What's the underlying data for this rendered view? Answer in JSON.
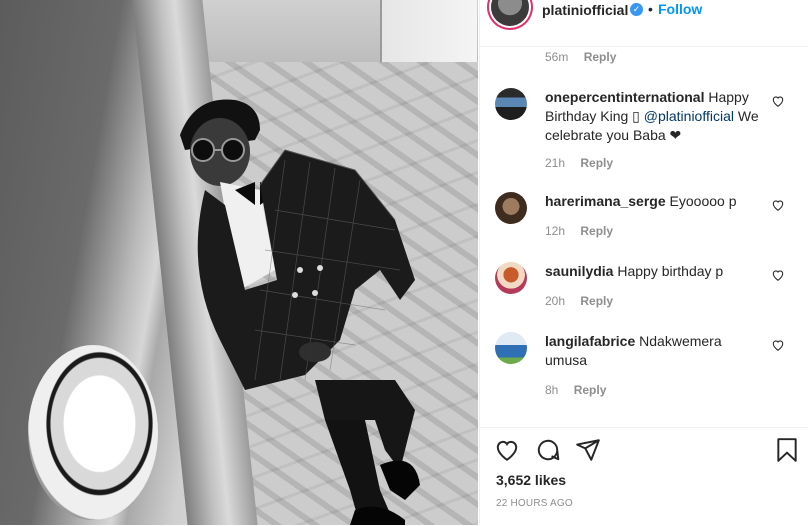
{
  "post": {
    "username": "platiniofficial",
    "verified": true,
    "separator": "•",
    "follow_label": "Follow",
    "photo_description_icon": "black-and-white-portrait-photo"
  },
  "top_meta": {
    "time": "56m",
    "reply_label": "Reply"
  },
  "comments": [
    {
      "username": "onepercentinternational",
      "text_before": "Happy Birthday King ▯ ",
      "mention": "@platiniofficial",
      "text_after": " We celebrate you Baba ❤",
      "time": "21h",
      "reply_label": "Reply"
    },
    {
      "username": "harerimana_serge",
      "text_before": "Eyooooo p",
      "mention": "",
      "text_after": "",
      "time": "12h",
      "reply_label": "Reply"
    },
    {
      "username": "saunilydia",
      "text_before": "Happy birthday p",
      "mention": "",
      "text_after": "",
      "time": "20h",
      "reply_label": "Reply"
    },
    {
      "username": "langilafabrice",
      "text_before": "Ndakwemera umusa",
      "mention": "",
      "text_after": "",
      "time": "8h",
      "reply_label": "Reply"
    }
  ],
  "likes": "3,652 likes",
  "timestamp": "22 HOURS AGO",
  "colors": {
    "link_blue": "#0095f6",
    "verified_blue": "#3897f0",
    "meta_gray": "#8e8e8e",
    "text": "#262626"
  },
  "icons": [
    "heart-icon",
    "comment-icon",
    "share-icon",
    "bookmark-icon",
    "verified-badge-icon",
    "like-comment-heart-icon"
  ]
}
